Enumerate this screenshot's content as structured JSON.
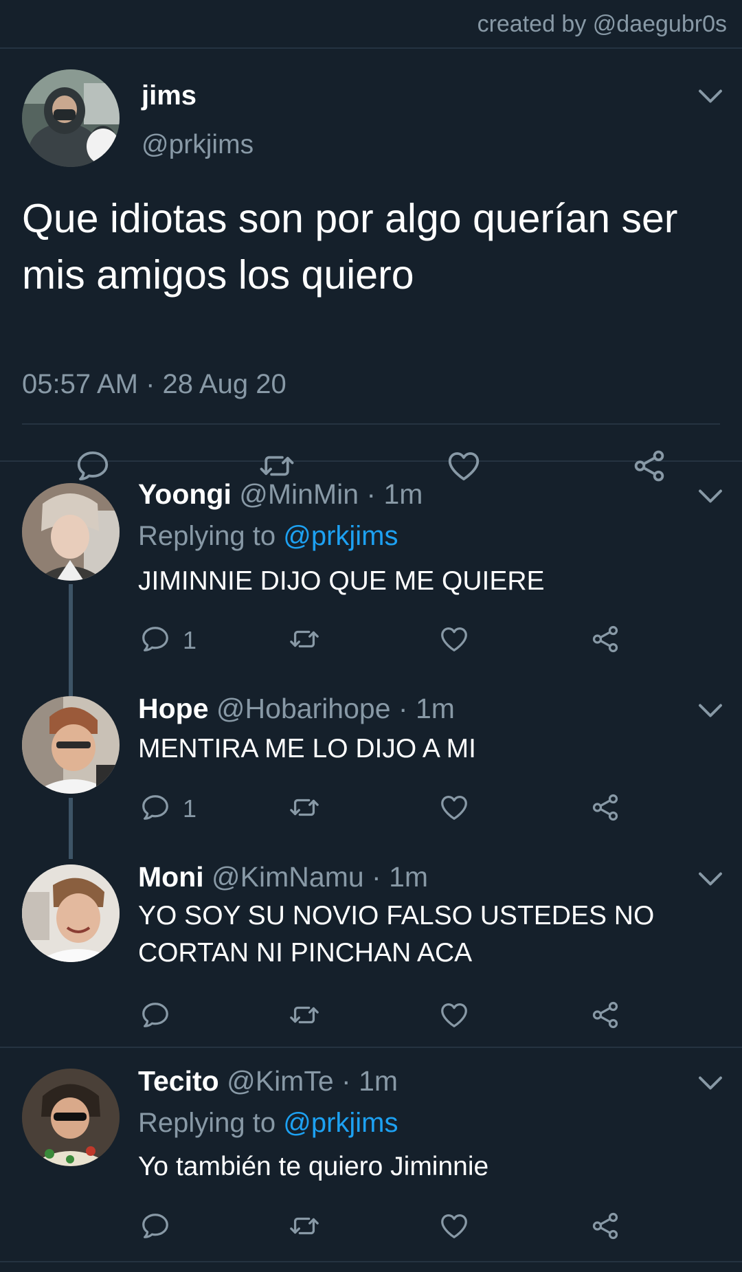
{
  "credit": "created by @daegubr0s",
  "main_tweet": {
    "name": "jims",
    "handle": "@prkjims",
    "text": "Que idiotas son por algo querían ser mis amigos los quiero",
    "timestamp": "05:57 AM · 28 Aug 20",
    "avatar": "profile-photo"
  },
  "replies": [
    {
      "name": "Yoongi",
      "meta": "@MinMin · 1m",
      "replying_prefix": "Replying to ",
      "replying_to": "@prkjims",
      "text": "JIMINNIE DIJO QUE ME QUIERE",
      "reply_count": "1"
    },
    {
      "name": "Hope",
      "meta": "@Hobarihope · 1m",
      "text": "MENTIRA ME LO DIJO A MI",
      "reply_count": "1"
    },
    {
      "name": "Moni",
      "meta": "@KimNamu · 1m",
      "text": "YO SOY SU NOVIO FALSO USTEDES NO CORTAN NI PINCHAN ACA",
      "reply_count": ""
    },
    {
      "name": "Tecito",
      "meta": "@KimTe · 1m",
      "replying_prefix": "Replying to ",
      "replying_to": "@prkjims",
      "text": "Yo también te quiero Jiminnie",
      "reply_count": ""
    }
  ],
  "colors": {
    "background": "#15202b",
    "secondary_text": "#8899a6",
    "accent": "#1da1f2",
    "divider": "#253341",
    "thread_line": "#3d5466"
  },
  "icons": [
    "reply-icon",
    "retweet-icon",
    "like-icon",
    "share-icon",
    "chevron-down-icon"
  ]
}
